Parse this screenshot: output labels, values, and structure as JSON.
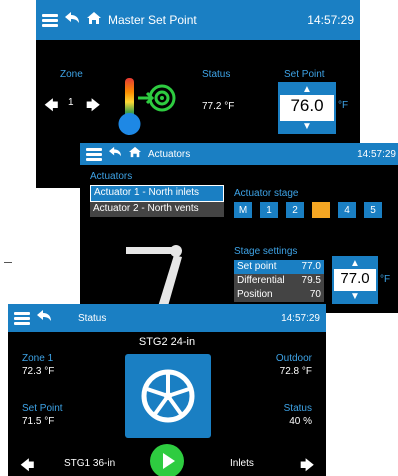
{
  "master": {
    "title": "Master Set Point",
    "time": "14:57:29",
    "zone_label": "Zone",
    "zone_value": "1",
    "status_label": "Status",
    "status_value": "77.2 °F",
    "setpoint_label": "Set Point",
    "setpoint_value": "76.0",
    "unit": "°F"
  },
  "actuators": {
    "title": "Actuators",
    "time": "14:57:29",
    "list_label": "Actuators",
    "items": [
      {
        "label": "Actuator 1 - North inlets",
        "selected": true
      },
      {
        "label": "Actuator 2 - North vents",
        "selected": false
      }
    ],
    "stage_label": "Actuator stage",
    "stages": [
      "M",
      "1",
      "2",
      "3",
      "4",
      "5"
    ],
    "active_stage": "3",
    "settings_label": "Stage settings",
    "settings": [
      {
        "name": "Set point",
        "value": "77.0"
      },
      {
        "name": "Differential",
        "value": "79.5"
      },
      {
        "name": "Position",
        "value": "70"
      }
    ],
    "stepper_value": "77.0",
    "unit": "°F"
  },
  "status": {
    "title": "Status",
    "time": "14:57:29",
    "stage_title": "STG2 24-in",
    "zone_label": "Zone 1",
    "zone_value": "72.3 °F",
    "outdoor_label": "Outdoor",
    "outdoor_value": "72.8 °F",
    "setpoint_label": "Set Point",
    "setpoint_value": "71.5 °F",
    "status_label": "Status",
    "status_value": "40 %",
    "prev_label": "STG1 36-in",
    "next_label": "Inlets"
  },
  "colors": {
    "accent": "#1a7fc3",
    "stage_active": "#f5a623",
    "play": "#2ecc40",
    "background": "#000000"
  }
}
